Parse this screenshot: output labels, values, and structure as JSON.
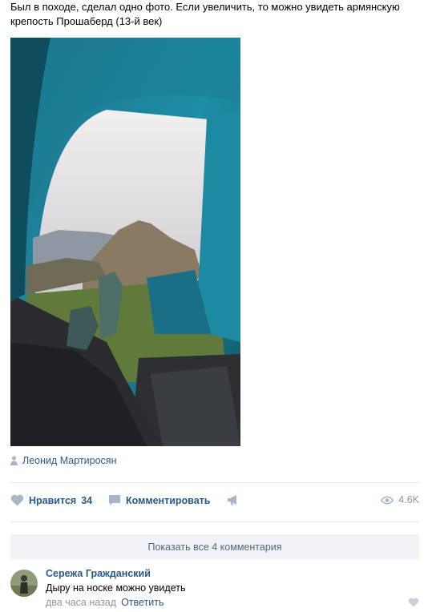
{
  "post": {
    "text": "Был в походе, сделал одно фото. Если увеличить, то можно увидеть армянскую крепость Прошаберд (13-й век)",
    "author_name": "Леонид Мартиросян"
  },
  "actions": {
    "like_label": "Нравится",
    "like_count": "34",
    "comment_label": "Комментировать",
    "views_count": "4.6K"
  },
  "comments": {
    "show_all_label": "Показать все 4 комментария",
    "items": [
      {
        "author": "Сережа Гражданский",
        "text": "Дыру на носке можно увидеть",
        "time": "два часа назад",
        "reply_label": "Ответить"
      }
    ]
  },
  "icons": {
    "author": "person-pin-icon",
    "like": "heart-icon",
    "comment": "comment-bubble-icon",
    "share": "megaphone-icon",
    "views": "eye-icon"
  },
  "colors": {
    "link": "#2a5885",
    "muted": "#939393",
    "show_all_bg": "#f0f2f5",
    "divider": "#e7e8ec"
  }
}
